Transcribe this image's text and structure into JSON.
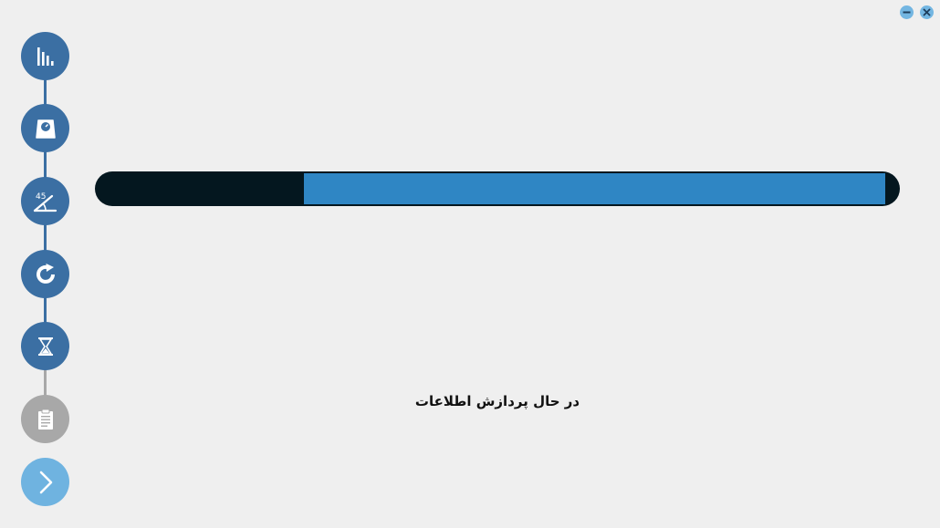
{
  "window": {
    "minimize_icon": "minimize-icon",
    "close_icon": "close-icon",
    "control_color": "#73b6e2"
  },
  "steps": [
    {
      "icon": "bar-chart-icon",
      "state": "completed"
    },
    {
      "icon": "scale-icon",
      "state": "completed"
    },
    {
      "icon": "angle-icon",
      "state": "completed",
      "icon_text": "45"
    },
    {
      "icon": "refresh-icon",
      "state": "completed"
    },
    {
      "icon": "hourglass-icon",
      "state": "completed"
    },
    {
      "icon": "clipboard-icon",
      "state": "pending"
    },
    {
      "icon": "chevron-right-icon",
      "state": "next"
    }
  ],
  "progress": {
    "fraction_remaining_dark_left": 0.26,
    "fill_color": "#2f86c4",
    "track_color": "#04171f"
  },
  "status": {
    "text": "در حال پردازش اطلاعات"
  },
  "colors": {
    "step_active": "#3b6fa3",
    "step_inactive": "#a8a8a8",
    "step_next": "#6fb3e0",
    "background": "#efefef"
  }
}
